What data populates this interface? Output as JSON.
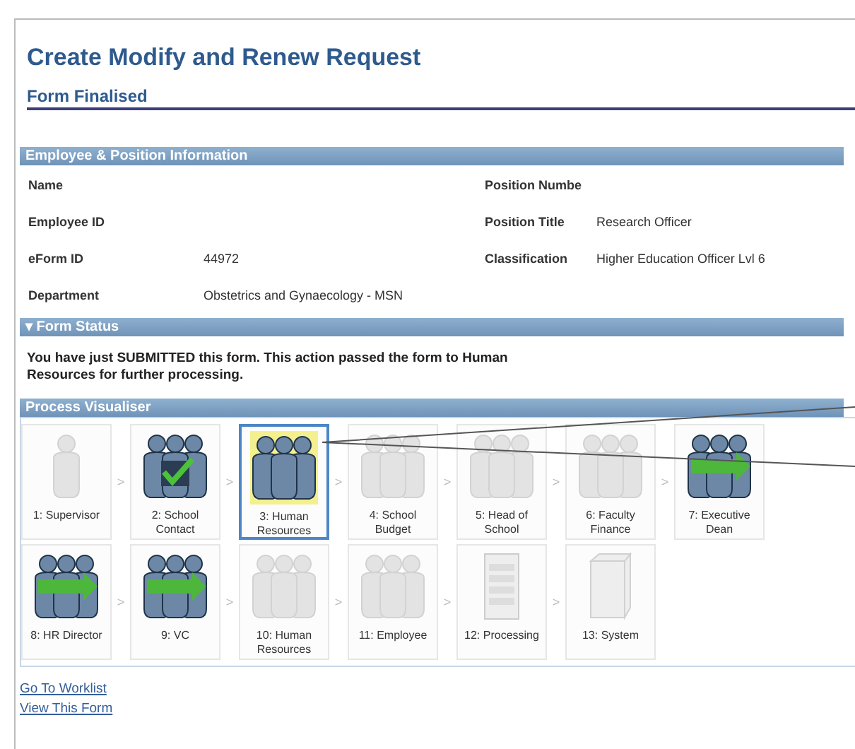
{
  "page": {
    "title": "Create Modify and Renew Request",
    "subtitle": "Form Finalised"
  },
  "employee_section": {
    "title": "Employee & Position Information",
    "fields": [
      {
        "label": "Name"
      },
      {
        "label": "Position Numbe"
      },
      {
        "label": "Employee ID"
      },
      {
        "label": "Position Title",
        "value": "Research Officer"
      },
      {
        "label": "eForm ID",
        "value": "44972"
      },
      {
        "label": "Classification",
        "value": "Higher Education Officer Lvl 6"
      },
      {
        "label": "Department",
        "value": "Obstetrics and Gynaecology - MSN"
      }
    ]
  },
  "status_section": {
    "toggle": "▾",
    "title": "Form Status",
    "message": "You have just SUBMITTED this form. This action passed the form to Human Resources for further processing."
  },
  "process_section": {
    "title": "Process Visualiser",
    "steps": [
      {
        "label": "1: Supervisor",
        "kind": "person",
        "active": false,
        "selected": false
      },
      {
        "label": "2: School Contact",
        "kind": "group-check",
        "active": true,
        "selected": false
      },
      {
        "label": "3: Human Resources",
        "kind": "group",
        "active": true,
        "selected": true
      },
      {
        "label": "4: School Budget",
        "kind": "group",
        "active": false,
        "selected": false
      },
      {
        "label": "5: Head of School",
        "kind": "group",
        "active": false,
        "selected": false
      },
      {
        "label": "6: Faculty Finance",
        "kind": "group",
        "active": false,
        "selected": false
      },
      {
        "label": "7: Executive Dean",
        "kind": "group-arrow",
        "active": true,
        "selected": false
      },
      {
        "label": "8: HR Director",
        "kind": "group-arrow",
        "active": true,
        "selected": false
      },
      {
        "label": "9: VC",
        "kind": "group-arrow",
        "active": true,
        "selected": false
      },
      {
        "label": "10: Human Resources",
        "kind": "group",
        "active": false,
        "selected": false
      },
      {
        "label": "11: Employee",
        "kind": "group",
        "active": false,
        "selected": false
      },
      {
        "label": "12: Processing",
        "kind": "document",
        "active": false,
        "selected": false
      },
      {
        "label": "13: System",
        "kind": "server",
        "active": false,
        "selected": false
      }
    ],
    "separator": ">"
  },
  "links": [
    "Go To Worklist",
    "View This Form"
  ]
}
